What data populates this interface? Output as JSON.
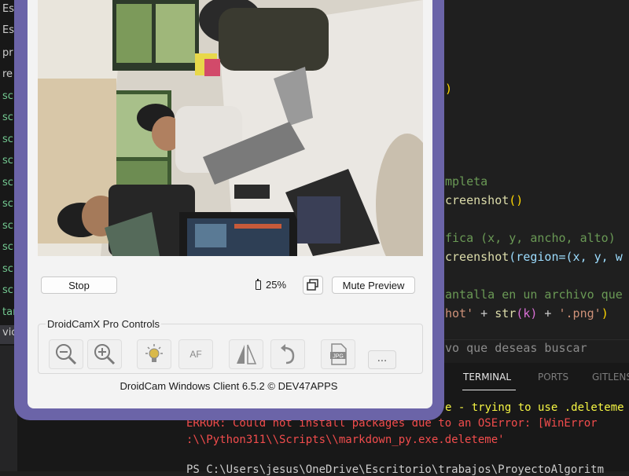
{
  "sidebar": {
    "rows": [
      {
        "text": "Es",
        "kind": "plain"
      },
      {
        "text": "Es",
        "kind": "plain"
      },
      {
        "text": "pr",
        "kind": "plain"
      },
      {
        "text": "re",
        "kind": "plain"
      },
      {
        "text": "sc",
        "kind": "green"
      },
      {
        "text": "sc",
        "kind": "green"
      },
      {
        "text": "sc",
        "kind": "green"
      },
      {
        "text": "sc",
        "kind": "green"
      },
      {
        "text": "sc",
        "kind": "green"
      },
      {
        "text": "sc",
        "kind": "green"
      },
      {
        "text": "sc",
        "kind": "green"
      },
      {
        "text": "sc",
        "kind": "green"
      },
      {
        "text": "sc",
        "kind": "green"
      },
      {
        "text": "sc",
        "kind": "green"
      },
      {
        "text": "tar",
        "kind": "green"
      },
      {
        "text": "vic",
        "kind": "plain"
      }
    ]
  },
  "editor": {
    "paren_close": ")",
    "comment1": "mpleta",
    "line2_fn": "creenshot",
    "line2_par": "()",
    "comment2": "fica (x, y, ancho, alto)",
    "line4_fn": "creenshot",
    "line4_rest": "(region=(x, y, w",
    "comment3": "antalla en un archivo que",
    "line6_str": "hot'",
    "line6_plus": " + ",
    "line6_fn": "str",
    "line6_k": "(k)",
    "line6_plus2": " + ",
    "line6_png": "'.png'",
    "line6_close": ")",
    "search_hint": "vo que deseas buscar"
  },
  "panel": {
    "tabs": [
      "TERMINAL",
      "PORTS",
      "GITLENS"
    ],
    "warning": "e - trying to use .deleteme",
    "error1": "ERROR: Could not install packages due to an OSError: [WinError",
    "error2": ":\\\\Python311\\\\Scripts\\\\markdown_py.exe.deleteme'",
    "prompt": "PS C:\\Users\\jesus\\OneDrive\\Escritorio\\trabajos\\ProyectoAlgoritm"
  },
  "droidcam": {
    "stop_label": "Stop",
    "battery": "25%",
    "mute_label": "Mute Preview",
    "controls_title": "DroidCamX Pro Controls",
    "af_label": "AF",
    "more_label": "...",
    "footer": "DroidCam Windows Client 6.5.2 © DEV47APPS",
    "frame_color": "#6b64a8",
    "icons": [
      "zoom-out-icon",
      "zoom-in-icon",
      "flash-icon",
      "autofocus-icon",
      "mirror-icon",
      "rotate-icon",
      "jpg-icon"
    ]
  }
}
